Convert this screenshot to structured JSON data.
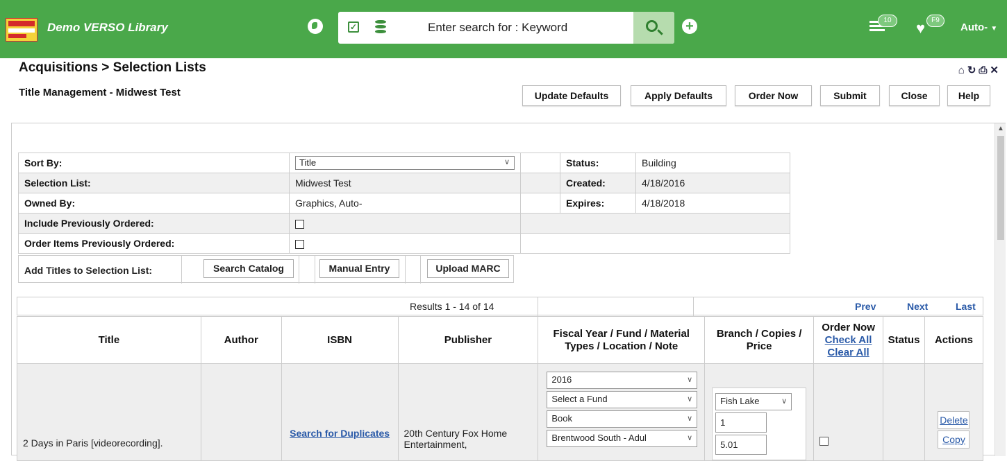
{
  "header": {
    "app_name": "Demo VERSO Library",
    "search_text": "Enter search for : Keyword",
    "list_badge": "10",
    "heart_badge": "F9",
    "user": "Auto-"
  },
  "page": {
    "title": "Acquisitions > Selection Lists",
    "subtitle": "Title Management - Midwest Test"
  },
  "toolbar": {
    "update_defaults": "Update Defaults",
    "apply_defaults": "Apply Defaults",
    "order_now": "Order Now",
    "submit": "Submit",
    "close": "Close",
    "help": "Help"
  },
  "meta": {
    "sort_by_label": "Sort By:",
    "sort_by_value": "Title",
    "status_label": "Status:",
    "status_value": "Building",
    "selection_list_label": "Selection List:",
    "selection_list_value": "Midwest Test",
    "created_label": "Created:",
    "created_value": "4/18/2016",
    "owned_by_label": "Owned By:",
    "owned_by_value": "Graphics, Auto-",
    "expires_label": "Expires:",
    "expires_value": "4/18/2018",
    "include_prev_label": "Include Previously Ordered:",
    "order_prev_label": "Order Items Previously Ordered:",
    "add_titles_label": "Add Titles to Selection List:",
    "search_catalog": "Search Catalog",
    "manual_entry": "Manual Entry",
    "upload_marc": "Upload MARC"
  },
  "pager": {
    "results": "Results 1 - 14 of 14",
    "prev": "Prev",
    "next": "Next",
    "last": "Last"
  },
  "columns": {
    "title": "Title",
    "author": "Author",
    "isbn": "ISBN",
    "publisher": "Publisher",
    "fund": "Fiscal Year / Fund / Material Types / Location / Note",
    "branch": "Branch / Copies / Price",
    "order_now": "Order Now",
    "check_all": "Check All",
    "clear_all": "Clear All",
    "status": "Status",
    "actions": "Actions"
  },
  "rows": [
    {
      "title": "2 Days in Paris [videorecording].",
      "author": "",
      "isbn_link": "Search for Duplicates",
      "publisher": "20th Century Fox Home Entertainment,",
      "fiscal_year": "2016",
      "fund": "Select a Fund",
      "material": "Book",
      "location": "Brentwood South - Adul",
      "branch": "Fish Lake",
      "copies": "1",
      "price": "5.01",
      "delete": "Delete",
      "copy": "Copy"
    }
  ],
  "colors": {
    "header_green": "#4aa84a",
    "link_blue": "#2a5aa8"
  }
}
